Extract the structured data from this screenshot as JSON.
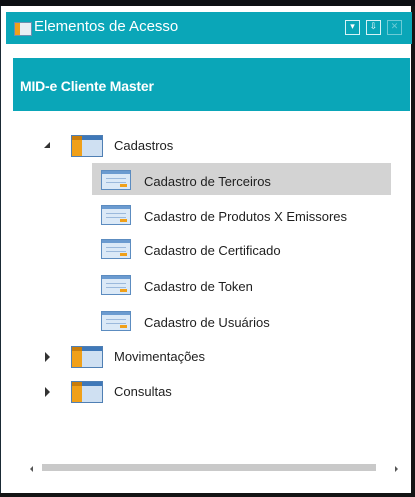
{
  "window": {
    "title": "Elementos de Acesso",
    "buttons": [
      {
        "name": "dropdown",
        "glyph": "▾"
      },
      {
        "name": "pin",
        "glyph": "⇩"
      },
      {
        "name": "close",
        "glyph": "✕"
      }
    ]
  },
  "header": {
    "title": "MID-e Cliente Master"
  },
  "tree": {
    "groups": [
      {
        "label": "Cadastros",
        "expanded": true,
        "items": [
          {
            "label": "Cadastro de Terceiros",
            "selected": true
          },
          {
            "label": "Cadastro de Produtos X Emissores",
            "selected": false
          },
          {
            "label": "Cadastro de Certificado",
            "selected": false
          },
          {
            "label": "Cadastro de Token",
            "selected": false
          },
          {
            "label": "Cadastro de Usuários",
            "selected": false
          }
        ]
      },
      {
        "label": "Movimentações",
        "expanded": false,
        "items": []
      },
      {
        "label": "Consultas",
        "expanded": false,
        "items": []
      }
    ]
  },
  "colors": {
    "accent": "#0aa6b8",
    "selection": "#d3d3d3"
  }
}
